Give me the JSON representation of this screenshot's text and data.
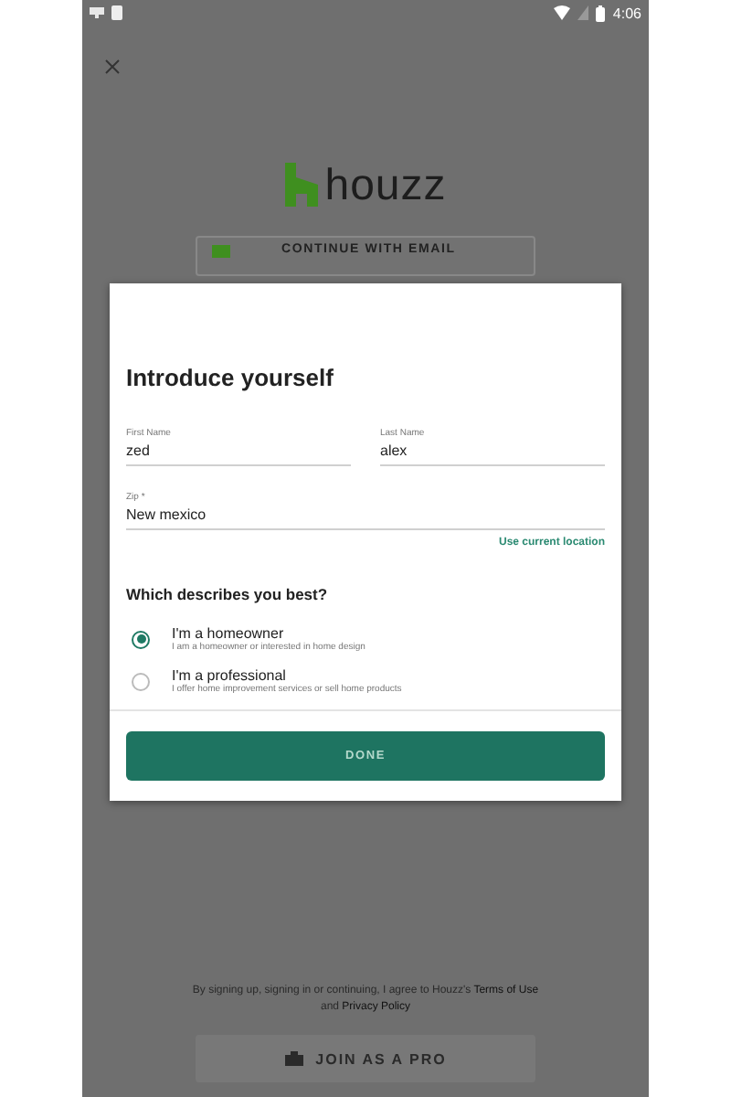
{
  "status_bar": {
    "time": "4:06"
  },
  "background": {
    "logo": "houzz",
    "email_button": "CONTINUE WITH EMAIL",
    "terms": "By signing up, signing in or continuing, I agree to Houzz's **Terms of Use** and **Privacy Policy**",
    "pro_button": "JOIN AS A PRO"
  },
  "dialog": {
    "title": "Introduce yourself",
    "fields": [
      {
        "label": "First Name",
        "value": "zed"
      },
      {
        "label": "Last Name",
        "value": "alex"
      },
      {
        "label": "Zip *",
        "value": "New mexico"
      }
    ],
    "location_link": "Use current location",
    "question": "Which describes you best?",
    "options": [
      {
        "title": "I'm a homeowner",
        "subtitle": "I am a homeowner or interested in home design",
        "selected": true
      },
      {
        "title": "I'm a professional",
        "subtitle": "I offer home improvement services or sell home products",
        "selected": false
      }
    ],
    "done_button": "DONE"
  }
}
